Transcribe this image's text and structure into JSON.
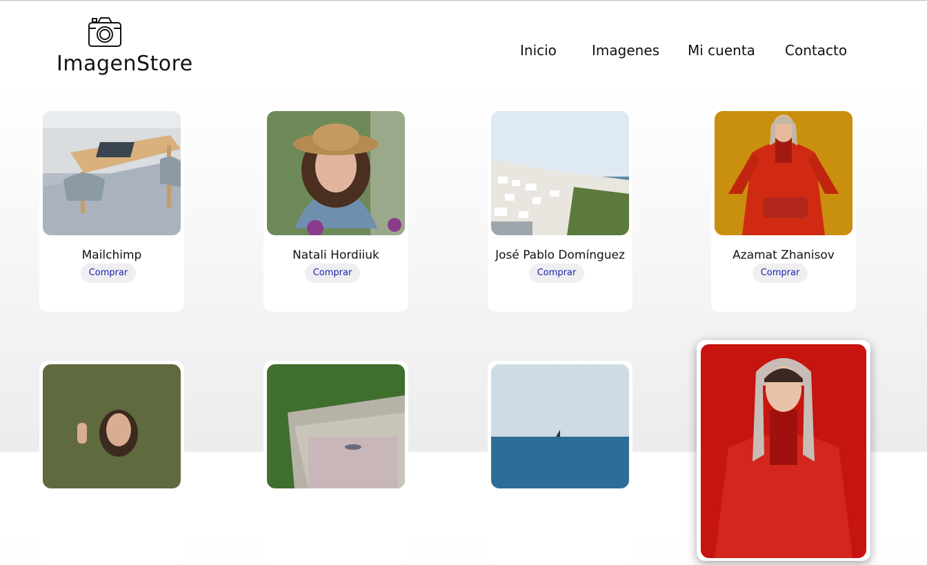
{
  "brand": {
    "name": "ImagenStore",
    "icon": "camera-icon"
  },
  "nav": {
    "items": [
      "Inicio",
      "Imagenes",
      "Mi cuenta",
      "Contacto"
    ]
  },
  "cards": [
    {
      "name": "Mailchimp",
      "button": "Comprar"
    },
    {
      "name": "Natali Hordiiuk",
      "button": "Comprar"
    },
    {
      "name": "José Pablo Domínguez",
      "button": "Comprar"
    },
    {
      "name": "Azamat Zhanisov",
      "button": "Comprar"
    }
  ],
  "colors": {
    "button_text": "#1c1cb0",
    "button_bg": "#efeff1"
  }
}
